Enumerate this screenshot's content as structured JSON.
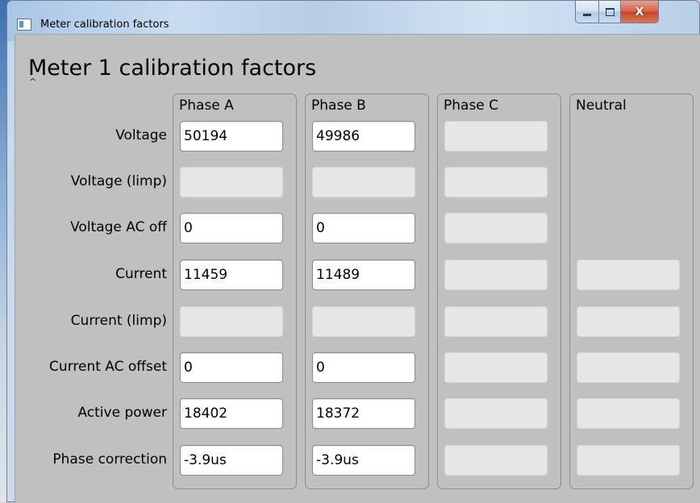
{
  "window": {
    "title": "Meter calibration factors",
    "controls": {
      "minimize_icon": "minimize-icon",
      "maximize_icon": "maximize-icon",
      "close_glyph": "X"
    }
  },
  "heading": "Meter 1 calibration factors",
  "heading_mark": "^",
  "columns": [
    "Phase A",
    "Phase B",
    "Phase C",
    "Neutral"
  ],
  "rows": [
    {
      "label": "Voltage",
      "values": [
        "50194",
        "49986",
        "",
        null
      ]
    },
    {
      "label": "Voltage (limp)",
      "values": [
        "",
        "",
        "",
        null
      ]
    },
    {
      "label": "Voltage AC off",
      "values": [
        "0",
        "0",
        "",
        null
      ]
    },
    {
      "label": "Current",
      "values": [
        "11459",
        "11489",
        "",
        ""
      ]
    },
    {
      "label": "Current (limp)",
      "values": [
        "",
        "",
        "",
        ""
      ]
    },
    {
      "label": "Current AC offset",
      "values": [
        "0",
        "0",
        "",
        ""
      ]
    },
    {
      "label": "Active power",
      "values": [
        "18402",
        "18372",
        "",
        ""
      ]
    },
    {
      "label": "Phase correction",
      "values": [
        "-3.9us",
        "-3.9us",
        "",
        ""
      ]
    }
  ],
  "colors": {
    "field_active_bg": "#ffffff",
    "field_disabled_bg": "#e6e6e6",
    "client_bg": "#c0c0c0",
    "close_button": "#c94a2c"
  }
}
